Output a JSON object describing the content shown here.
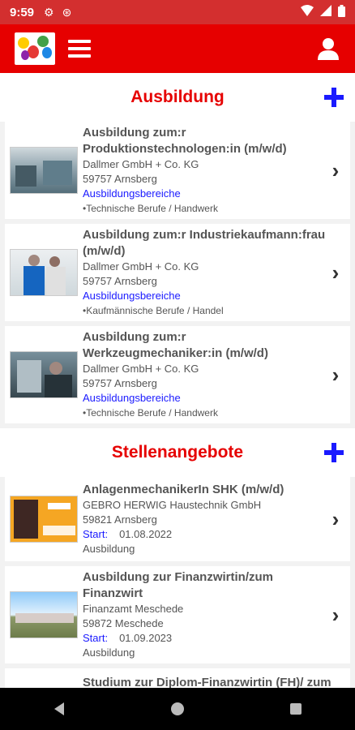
{
  "status": {
    "time": "9:59"
  },
  "colors": {
    "brand": "#e60000",
    "link": "#1a1aff",
    "text": "#555555"
  },
  "icons": {
    "menu": "hamburger-menu-icon",
    "user": "user-icon",
    "add": "plus-icon",
    "chevron": "chevron-right-icon"
  },
  "ausbildung": {
    "title": "Ausbildung",
    "items": [
      {
        "title": "Ausbildung zum:r Produktionstechnologen:in (m/w/d)",
        "company": "Dallmer GmbH + Co. KG",
        "location": "59757 Arnsberg",
        "link": "Ausbildungsbereiche",
        "category": "•Technische Berufe / Handwerk"
      },
      {
        "title": "Ausbildung zum:r Industriekaufmann:frau (m/w/d)",
        "company": "Dallmer GmbH + Co. KG",
        "location": "59757 Arnsberg",
        "link": "Ausbildungsbereiche",
        "category": "•Kaufmännische Berufe / Handel"
      },
      {
        "title": "Ausbildung zum:r Werkzeugmechaniker:in (m/w/d)",
        "company": "Dallmer GmbH + Co. KG",
        "location": "59757 Arnsberg",
        "link": "Ausbildungsbereiche",
        "category": "•Technische Berufe / Handwerk"
      }
    ]
  },
  "stellen": {
    "title": "Stellenangebote",
    "items": [
      {
        "title": "AnlagenmechanikerIn SHK (m/w/d)",
        "company": "GEBRO HERWIG Haustechnik GmbH",
        "location": "59821 Arnsberg",
        "start_label": "Start:",
        "start": "01.08.2022",
        "type": "Ausbildung"
      },
      {
        "title": "Ausbildung zur Finanzwirtin/zum Finanzwirt",
        "company": "Finanzamt Meschede",
        "location": "59872 Meschede",
        "start_label": "Start:",
        "start": "01.09.2023",
        "type": "Ausbildung"
      },
      {
        "title": "Studium zur Diplom-Finanzwirtin (FH)/ zum Diplom-Finanzwirt (FH)"
      }
    ]
  }
}
